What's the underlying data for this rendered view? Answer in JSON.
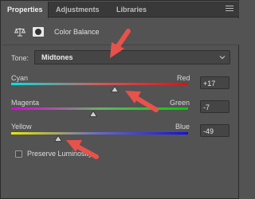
{
  "tabs": [
    {
      "label": "Properties",
      "active": true
    },
    {
      "label": "Adjustments",
      "active": false
    },
    {
      "label": "Libraries",
      "active": false
    }
  ],
  "header": {
    "title": "Color Balance",
    "adjustment_icon": "balance-scale-icon",
    "mask_icon": "layer-mask-icon"
  },
  "tone": {
    "label": "Tone:",
    "value": "Midtones"
  },
  "sliders": [
    {
      "left_label": "Cyan",
      "right_label": "Red",
      "value": "+17",
      "position": 0.585,
      "gradient": [
        "#00e5e5",
        "#d05a5a",
        "#e01010"
      ]
    },
    {
      "left_label": "Magenta",
      "right_label": "Green",
      "value": "-7",
      "position": 0.465,
      "gradient": [
        "#e000e0",
        "#6ab06a",
        "#00d000"
      ]
    },
    {
      "left_label": "Yellow",
      "right_label": "Blue",
      "value": "-49",
      "position": 0.265,
      "gradient": [
        "#e8e800",
        "#6868c8",
        "#1010e8"
      ]
    }
  ],
  "checkbox": {
    "label": "Preserve Luminosity",
    "checked": false
  },
  "colors": {
    "panel_bg": "#535353",
    "tab_bg": "#393939",
    "annotation_arrow": "#e8524a"
  }
}
